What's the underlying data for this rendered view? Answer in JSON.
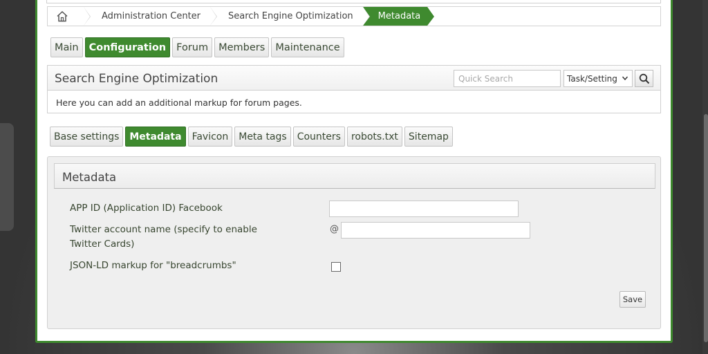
{
  "breadcrumb": {
    "items": [
      "Administration Center",
      "Search Engine Optimization",
      "Metadata"
    ]
  },
  "main_tabs": [
    "Main",
    "Configuration",
    "Forum",
    "Members",
    "Maintenance"
  ],
  "seo": {
    "title": "Search Engine Optimization",
    "quick_search_placeholder": "Quick Search",
    "select_value": "Task/Setting",
    "description": "Here you can add an additional markup for forum pages."
  },
  "sub_tabs": [
    "Base settings",
    "Metadata",
    "Favicon",
    "Meta tags",
    "Counters",
    "robots.txt",
    "Sitemap"
  ],
  "metadata": {
    "title": "Metadata",
    "fields": {
      "facebook_label": "APP ID (Application ID) Facebook",
      "facebook_value": "",
      "twitter_label": "Twitter account name (specify to enable Twitter Cards)",
      "twitter_prefix": "@",
      "twitter_value": "",
      "jsonld_label": "JSON-LD markup for \"breadcrumbs\"",
      "jsonld_checked": false
    },
    "save_label": "Save"
  },
  "colors": {
    "accent": "#3f8a2f"
  }
}
